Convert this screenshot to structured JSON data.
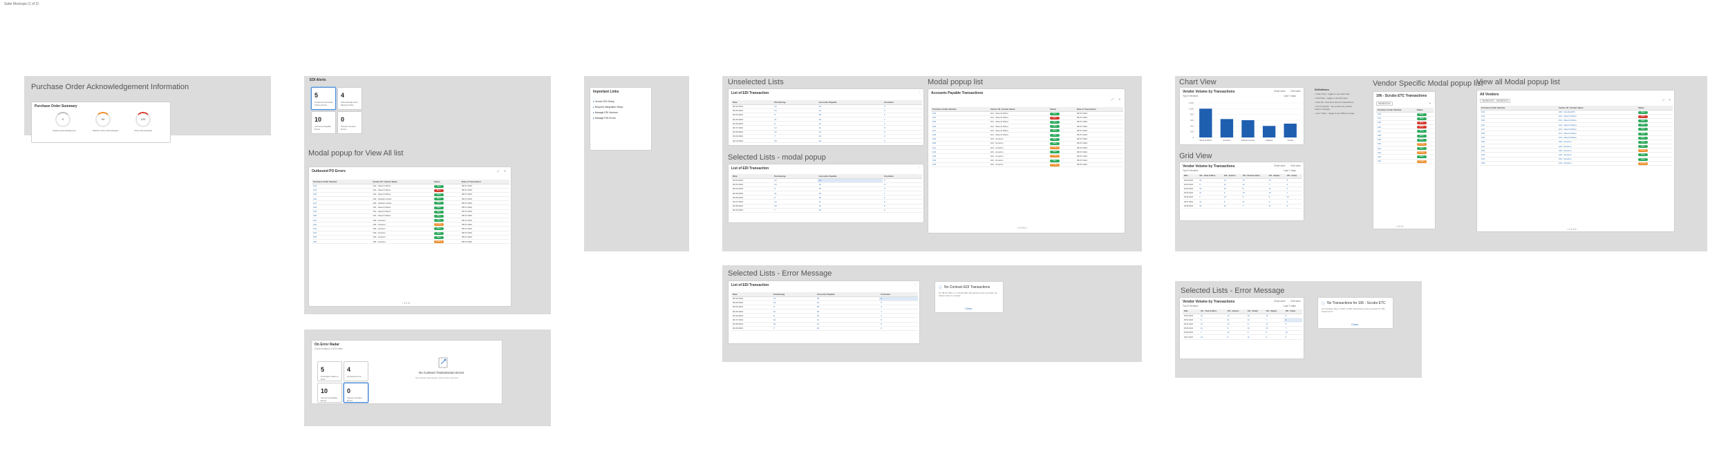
{
  "canvas_label": "Suite Mockups (1 of 2)",
  "po_ack": {
    "frame_title": "Purchase Order Acknowledgement Information",
    "card_title": "Purchase Order Summary",
    "gauges": [
      {
        "value": "0",
        "label": "Awaiting Acknowledgement"
      },
      {
        "value": "94",
        "label": "Matches Order Acknowledged"
      },
      {
        "value": "120",
        "label": "Order Acknowledged"
      }
    ]
  },
  "edi_alerts": {
    "card_title": "EDI Alerts",
    "tiles": [
      {
        "value": "5",
        "label": "Outbound Purchase Orders Errors"
      },
      {
        "value": "4",
        "label": "Acknowledgement Missing Order"
      },
      {
        "value": "10",
        "label": "Accounts Payable Errors"
      },
      {
        "value": "0",
        "label": "Vendor Contract Errors"
      }
    ]
  },
  "modal_view_all": {
    "frame_title": "Modal popup for View All list",
    "card_title": "Outbound PO Errors",
    "columns": [
      "Purchase Order Number",
      "Vendor ID / Vendor Name",
      "Status",
      "Date of Transaction"
    ],
    "rows": [
      [
        "123",
        "101 - Steel & Wires",
        "Open",
        "08.07.2024"
      ],
      [
        "124",
        "101 - Steel & Wires",
        "Error",
        "08.07.2024"
      ],
      [
        "125",
        "101 - Steel & Wires",
        "Open",
        "08.07.2024"
      ],
      [
        "126",
        "102 - Global Lumber",
        "Open",
        "08.07.2024"
      ],
      [
        "127",
        "102 - Global Lumber",
        "Open",
        "08.07.2024"
      ],
      [
        "128",
        "101 - Steel & Wires",
        "Open",
        "08.07.2024"
      ],
      [
        "129",
        "101 - Steel & Wires",
        "Open",
        "08.07.2024"
      ],
      [
        "130",
        "101 - Steel & Wires",
        "Open",
        "08.07.2024"
      ],
      [
        "131",
        "103 - Amazon",
        "Open",
        "08.07.2024"
      ],
      [
        "132",
        "103 - Amazon",
        "Pending",
        "08.07.2024"
      ],
      [
        "133",
        "103 - Amazon",
        "Open",
        "08.07.2024"
      ],
      [
        "134",
        "103 - Amazon",
        "Open",
        "08.07.2024"
      ],
      [
        "135",
        "103 - Amazon",
        "Open",
        "08.07.2024"
      ],
      [
        "136",
        "103 - Amazon",
        "Pending",
        "08.07.2024"
      ]
    ],
    "pager": "‹ 1 2 3 ›"
  },
  "zero_state": {
    "card_title": "On Error Radar",
    "card_sub": "Current status of EDI data",
    "tiles": [
      {
        "value": "5",
        "label": "Purchase Orders in Error"
      },
      {
        "value": "4",
        "label": "Contract Errors"
      },
      {
        "value": "10",
        "label": "Accounts Payable Errors"
      },
      {
        "value": "0",
        "label": "Vendor Contract Errors"
      }
    ],
    "empty_title": "No Contract Transmission Errors",
    "empty_text": "No contract transmission errors have occurred."
  },
  "important_links": {
    "card_title": "Important Links",
    "links": [
      "Vendor EDI Setup",
      "Request Integration Setup",
      "Manage EDI Vendors",
      "Manage EDI Errors"
    ]
  },
  "unselected_lists": {
    "frame_title": "Unselected Lists",
    "card_title": "List of EDI Transaction",
    "columns": [
      "Date",
      "Purchasing",
      "Accounts Payable",
      "Contracts"
    ],
    "rows": [
      [
        "06.02.2024",
        "12",
        "23",
        "4"
      ],
      [
        "06.03.2024",
        "14",
        "12",
        "3"
      ],
      [
        "06.04.2024",
        "9",
        "18",
        "2"
      ],
      [
        "06.05.2024",
        "11",
        "20",
        "7"
      ],
      [
        "06.06.2024",
        "8",
        "15",
        "1"
      ],
      [
        "06.07.2024",
        "13",
        "11",
        "5"
      ],
      [
        "06.08.2024",
        "10",
        "14",
        "6"
      ],
      [
        "06.09.2024",
        "7",
        "16",
        "2"
      ],
      [
        "06.10.2024",
        "15",
        "19",
        "3"
      ]
    ]
  },
  "selected_modal": {
    "frame_title": "Selected Lists - modal popup",
    "card_title": "List of EDI Transaction",
    "columns": [
      "Date",
      "Purchasing",
      "Accounts Payable",
      "Contracts"
    ],
    "rows": [
      [
        "06.02.2024",
        "12",
        "23",
        "4"
      ],
      [
        "06.03.2024",
        "14",
        "12",
        "3"
      ],
      [
        "06.04.2024",
        "9",
        "18",
        "2"
      ],
      [
        "06.05.2024",
        "11",
        "20",
        "7"
      ],
      [
        "06.06.2024",
        "8",
        "15",
        "1"
      ],
      [
        "06.07.2024",
        "13",
        "11",
        "5"
      ],
      [
        "06.08.2024",
        "10",
        "14",
        "6"
      ],
      [
        "06.09.2024",
        "7",
        "16",
        "2"
      ]
    ]
  },
  "modal_popup_list": {
    "frame_title": "Modal popup list",
    "card_title": "Accounts Payable Transactions",
    "columns": [
      "Purchase Order Number",
      "Vendor ID / Vendor Name",
      "Status",
      "Date of Transaction"
    ],
    "rows": [
      [
        "123",
        "101 - Steel & Wires",
        "Open",
        "08.07.2024"
      ],
      [
        "124",
        "101 - Steel & Wires",
        "Error",
        "08.07.2024"
      ],
      [
        "125",
        "101 - Steel & Wires",
        "Open",
        "08.07.2024"
      ],
      [
        "126",
        "101 - Steel & Wires",
        "Open",
        "08.07.2024"
      ],
      [
        "127",
        "101 - Steel & Wires",
        "Open",
        "08.07.2024"
      ],
      [
        "128",
        "101 - Steel & Wires",
        "Open",
        "08.07.2024"
      ],
      [
        "129",
        "103 - Amazon",
        "Open",
        "08.07.2024"
      ],
      [
        "130",
        "103 - Amazon",
        "Open",
        "08.07.2024"
      ],
      [
        "131",
        "103 - Amazon",
        "Pending",
        "08.07.2024"
      ],
      [
        "132",
        "103 - Amazon",
        "Open",
        "08.07.2024"
      ],
      [
        "133",
        "103 - Amazon",
        "Pending",
        "08.07.2024"
      ],
      [
        "134",
        "103 - Amazon",
        "Open",
        "08.07.2024"
      ],
      [
        "135",
        "103 - Amazon",
        "Pending",
        "08.07.2024"
      ]
    ],
    "pager": "‹ 1 2 3 4 ›"
  },
  "error_message_1": {
    "frame_title": "Selected Lists - Error Message",
    "card_title": "List of EDI Transaction",
    "columns": [
      "Date",
      "Purchasing",
      "Accounts Payable",
      "Contracts"
    ],
    "rows": [
      [
        "06.02.2024",
        "12",
        "23",
        "4"
      ],
      [
        "06.03.2024",
        "14",
        "12",
        "3"
      ],
      [
        "06.04.2024",
        "9",
        "18",
        "2"
      ],
      [
        "06.05.2024",
        "11",
        "20",
        "7"
      ],
      [
        "06.06.2024",
        "8",
        "15",
        "1"
      ],
      [
        "06.07.2024",
        "13",
        "11",
        "5"
      ],
      [
        "06.08.2024",
        "10",
        "14",
        "6"
      ],
      [
        "06.09.2024",
        "7",
        "16",
        "2"
      ]
    ],
    "dialog_title": "No Contract EDI Transactions",
    "dialog_text": "On 08.07.2024, no contract EDI transactions were recorded. No further action is needed.",
    "dialog_button": "Close"
  },
  "chart_view": {
    "frame_title": "Chart View",
    "card_title": "Vendor Volume by Transactions",
    "filter_label": "Top 5 Vendors",
    "legend_label": "Last 7 days",
    "toggle_chart": "Chart view",
    "toggle_grid": "Grid view",
    "chart_data": {
      "type": "bar",
      "categories": [
        "Steel & Wires",
        "Amazon",
        "Global Lumber",
        "Staples",
        "Cintas"
      ],
      "values": [
        1000,
        640,
        600,
        400,
        480
      ],
      "ylim": [
        0,
        1200
      ],
      "yticks": [
        "1,200",
        "1,000",
        "800",
        "600",
        "400",
        "200",
        "0"
      ]
    }
  },
  "definitions": {
    "title": "Definitions",
    "items": [
      "Chart View - toggle to see chart view",
      "Grid View - toggle to see grid view",
      "View All - view all vendors & transactions",
      "Top 5 Vendors - top vendors by volume, select to change",
      "Last 7 days - toggle to see different range"
    ]
  },
  "grid_view": {
    "frame_title": "Grid View",
    "card_title": "Vendor Volume by Transactions",
    "filter_label": "Top 5 Vendors",
    "legend_label": "Last 7 days",
    "toggle_chart": "Chart view",
    "toggle_grid": "Grid view",
    "columns": [
      "Date",
      "101 - Steel & Wires",
      "102 - Amazon",
      "103 - Global Lumber",
      "104 - Staples",
      "105 - Cintas"
    ],
    "rows": [
      [
        "06.02.2024",
        "12",
        "14",
        "10",
        "13",
        "8"
      ],
      [
        "06.03.2024",
        "9",
        "11",
        "12",
        "7",
        "9"
      ],
      [
        "06.04.2024",
        "14",
        "10",
        "8",
        "11",
        "6"
      ],
      [
        "06.05.2024",
        "11",
        "9",
        "13",
        "10",
        "7"
      ],
      [
        "06.06.2024",
        "7",
        "12",
        "9",
        "8",
        "10"
      ],
      [
        "06.07.2024",
        "13",
        "8",
        "11",
        "9",
        "5"
      ],
      [
        "06.08.2024",
        "10",
        "13",
        "7",
        "12",
        "9"
      ]
    ]
  },
  "vendor_modal": {
    "frame_title": "Vendor Specific Modal popup list",
    "card_title": "106 - Scrubs ETC Transactions",
    "date_range": "06/08/2024",
    "columns": [
      "Purchase Order Number",
      "Status"
    ],
    "rows": [
      [
        "123",
        "Open"
      ],
      [
        "124",
        "Open"
      ],
      [
        "125",
        "Error"
      ],
      [
        "126",
        "Error"
      ],
      [
        "127",
        "Open"
      ],
      [
        "128",
        "Open"
      ],
      [
        "129",
        "Open"
      ],
      [
        "130",
        "Pending"
      ],
      [
        "131",
        "Open"
      ],
      [
        "132",
        "Pending"
      ],
      [
        "133",
        "Open"
      ],
      [
        "134",
        "Pending"
      ]
    ],
    "pager": "‹ 1 2 3 ›"
  },
  "view_all_modal": {
    "frame_title": "View all Modal popup list",
    "card_title": "All Vendors",
    "date_range": "06/08/2024 - 06/08/2024",
    "columns": [
      "Purchase Order Number",
      "Vendor ID / Vendor Name",
      "Status"
    ],
    "rows": [
      [
        "123",
        "106 - Scrubs ETC",
        "Open"
      ],
      [
        "124",
        "101 - Steel & Wires",
        "Error"
      ],
      [
        "125",
        "101 - Steel & Wires",
        "Open"
      ],
      [
        "126",
        "101 - Steel & Wires",
        "Open"
      ],
      [
        "127",
        "101 - Steel & Wires",
        "Open"
      ],
      [
        "128",
        "101 - Steel & Wires",
        "Open"
      ],
      [
        "129",
        "101 - Steel & Wires",
        "Open"
      ],
      [
        "130",
        "102 - Amazon",
        "Open"
      ],
      [
        "131",
        "102 - Amazon",
        "Open"
      ],
      [
        "132",
        "102 - Amazon",
        "Pending"
      ],
      [
        "133",
        "102 - Amazon",
        "Open"
      ],
      [
        "134",
        "102 - Amazon",
        "Open"
      ],
      [
        "135",
        "102 - Amazon",
        "Pending"
      ]
    ],
    "pager": "‹ 1 2 3 4 ›"
  },
  "error_message_2": {
    "frame_title": "Selected Lists - Error Message",
    "card_title": "Vendor Volume by Transactions",
    "filter_label": "Top 5 Vendors",
    "legend_label": "Last 7 days",
    "toggle_chart": "Chart view",
    "toggle_grid": "Grid view",
    "columns": [
      "Date",
      "101 - Steel & Wires",
      "102 - Amazon",
      "103 - Global",
      "104 - Staples",
      "105 - Cintas"
    ],
    "rows": [
      [
        "06.02.2024",
        "12",
        "14",
        "10",
        "13",
        "8"
      ],
      [
        "06.03.2024",
        "9",
        "11",
        "12",
        "7",
        "0"
      ],
      [
        "06.04.2024",
        "14",
        "10",
        "8",
        "11",
        "6"
      ],
      [
        "06.05.2024",
        "11",
        "9",
        "13",
        "10",
        "7"
      ],
      [
        "06.06.2024",
        "7",
        "12",
        "9",
        "8",
        "10"
      ],
      [
        "06.07.2024",
        "13",
        "8",
        "11",
        "9",
        "5"
      ]
    ],
    "dialog_title": "No Transactions for 106 - Scrubs ETC",
    "dialog_text": "On Tuesday, May 2, 2024 no EDI transactions were recorded for 106 - Scrubs ETC.",
    "dialog_button": "Close"
  }
}
